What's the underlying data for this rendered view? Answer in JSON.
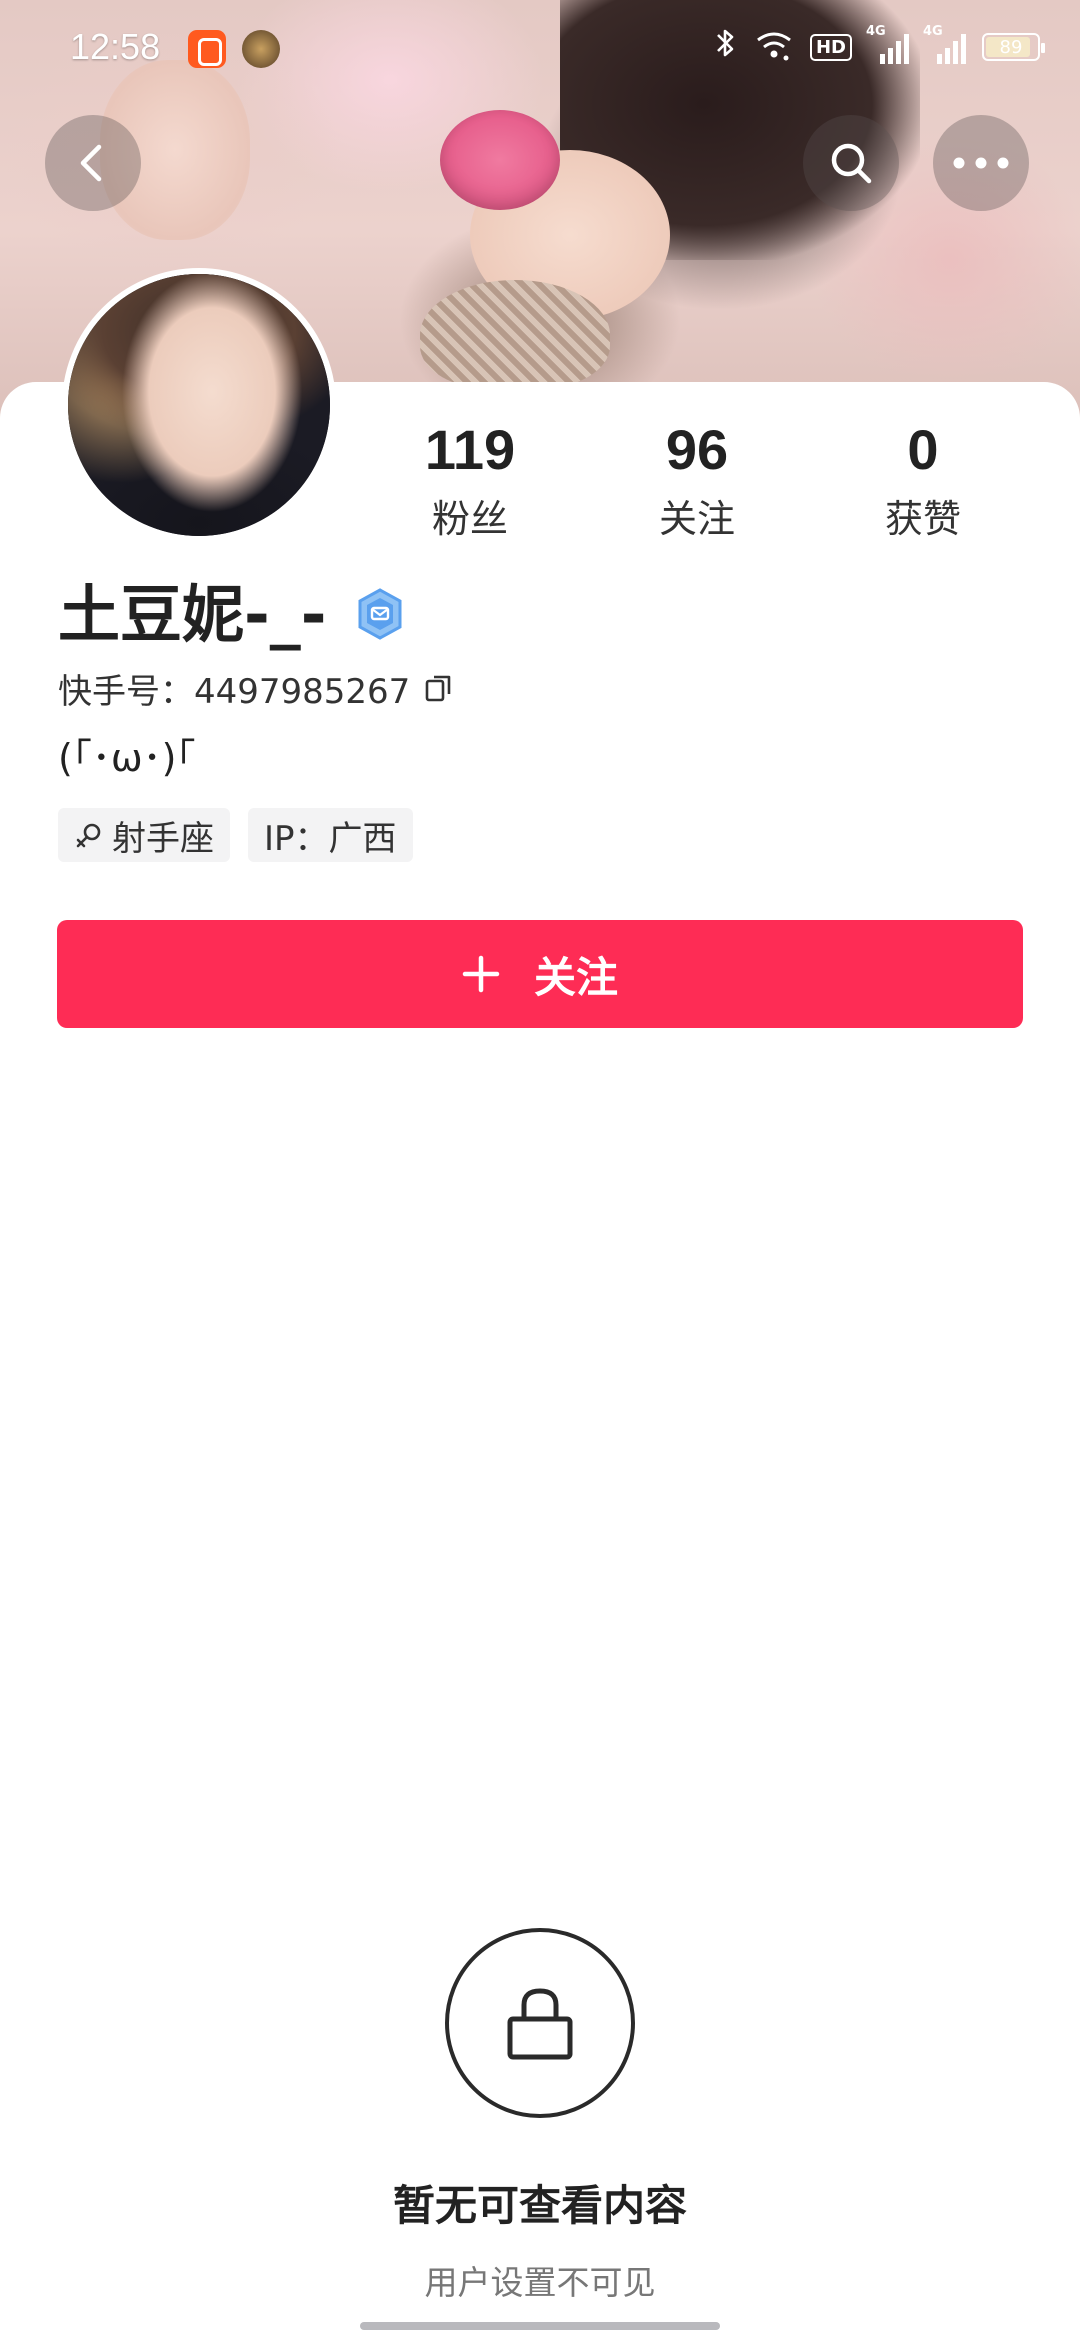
{
  "status_bar": {
    "time": "12:58",
    "hd_label": "HD",
    "network_1": "4G",
    "network_2": "4G",
    "battery_level": "89",
    "battery_fraction": 0.89,
    "icons": [
      "kuaishou-app-icon",
      "game-app-icon",
      "bluetooth-icon",
      "wifi-icon",
      "signal-icon",
      "battery-icon"
    ]
  },
  "nav": {
    "back_icon": "chevron-left-icon",
    "search_icon": "search-icon",
    "more_icon": "more-dots-icon"
  },
  "profile": {
    "name": "土豆妮-_-",
    "uid_label": "快手号：4497985267",
    "bio": "(｢･ω･)｢",
    "tags": {
      "zodiac": "射手座",
      "ip": "IP：广西"
    },
    "stats": {
      "fans_value": "119",
      "fans_label": "粉丝",
      "following_value": "96",
      "following_label": "关注",
      "likes_value": "0",
      "likes_label": "获赞"
    }
  },
  "follow_button": {
    "label": "关注"
  },
  "empty_state": {
    "title": "暂无可查看内容",
    "subtitle": "用户设置不可见"
  },
  "colors": {
    "accent": "#fe2c55",
    "badge": "#5aa0ee"
  }
}
